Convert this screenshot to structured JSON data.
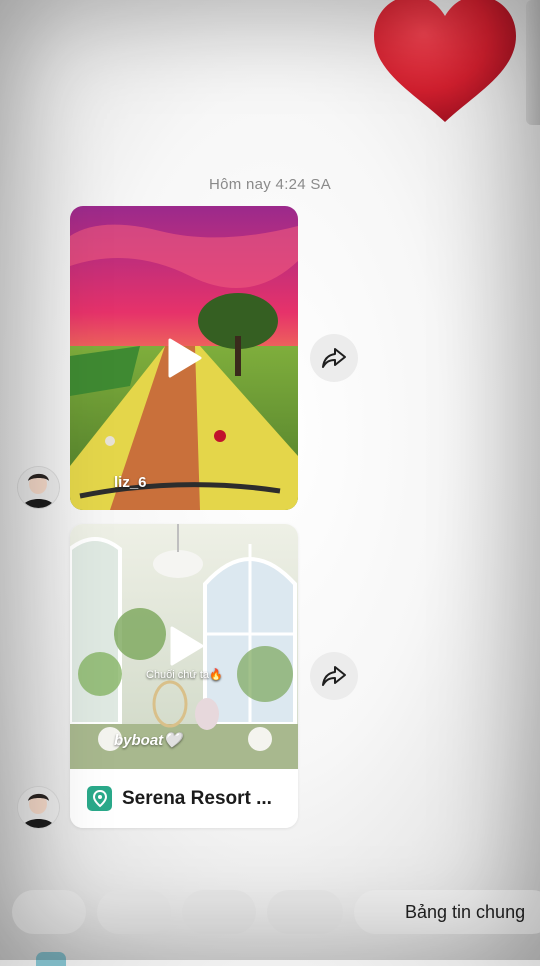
{
  "chat": {
    "timestamp": "Hôm nay 4:24 SA",
    "messages": [
      {
        "type": "video",
        "username": "liz_6"
      },
      {
        "type": "video",
        "caption": "Chuối chứ ta🔥",
        "watermark": "byboat🤍",
        "location": "Serena Resort ..."
      }
    ]
  },
  "chips": {
    "items": [
      "",
      "",
      "",
      ""
    ],
    "labeled": "Bảng tin chung"
  },
  "icons": {
    "reaction": "heart-icon",
    "play": "play-icon",
    "share": "share-icon",
    "location": "location-pin-icon"
  },
  "colors": {
    "heart": "#d11f2e",
    "location_pin": "#2aa98a"
  }
}
